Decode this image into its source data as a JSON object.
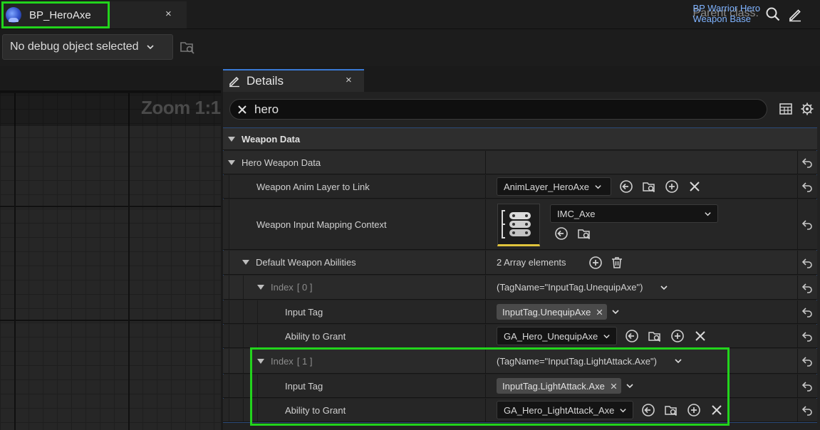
{
  "document_tab": {
    "title": "BP_HeroAxe",
    "close": "×"
  },
  "parent_class": {
    "label": "Parent class:",
    "value": "BP Warrior Hero Weapon Base"
  },
  "debug": {
    "selected": "No debug object selected"
  },
  "graph": {
    "zoom": "Zoom 1:1"
  },
  "details": {
    "tab_title": "Details",
    "tab_close": "×",
    "search_value": "hero",
    "category": "Weapon Data",
    "hero_weapon_data": "Hero Weapon Data",
    "anim_layer": {
      "label": "Weapon Anim Layer to Link",
      "value": "AnimLayer_HeroAxe"
    },
    "input_mapping": {
      "label": "Weapon Input Mapping Context",
      "value": "IMC_Axe"
    },
    "abilities": {
      "label": "Default Weapon Abilities",
      "count": "2 Array elements"
    },
    "index0": {
      "label": "Index",
      "index": "[ 0 ]",
      "summary": "(TagName=\"InputTag.UnequipAxe\")",
      "input_tag_label": "Input Tag",
      "input_tag": "InputTag.UnequipAxe",
      "ability_label": "Ability to Grant",
      "ability": "GA_Hero_UnequipAxe"
    },
    "index1": {
      "label": "Index",
      "index": "[ 1 ]",
      "summary": "(TagName=\"InputTag.LightAttack.Axe\")",
      "input_tag_label": "Input Tag",
      "input_tag": "InputTag.LightAttack.Axe",
      "ability_label": "Ability to Grant",
      "ability": "GA_Hero_LightAttack_Axe"
    }
  },
  "colors": {
    "highlight": "#22d41c",
    "link": "#7fb3ff",
    "accent_tab": "#3a79d4"
  }
}
